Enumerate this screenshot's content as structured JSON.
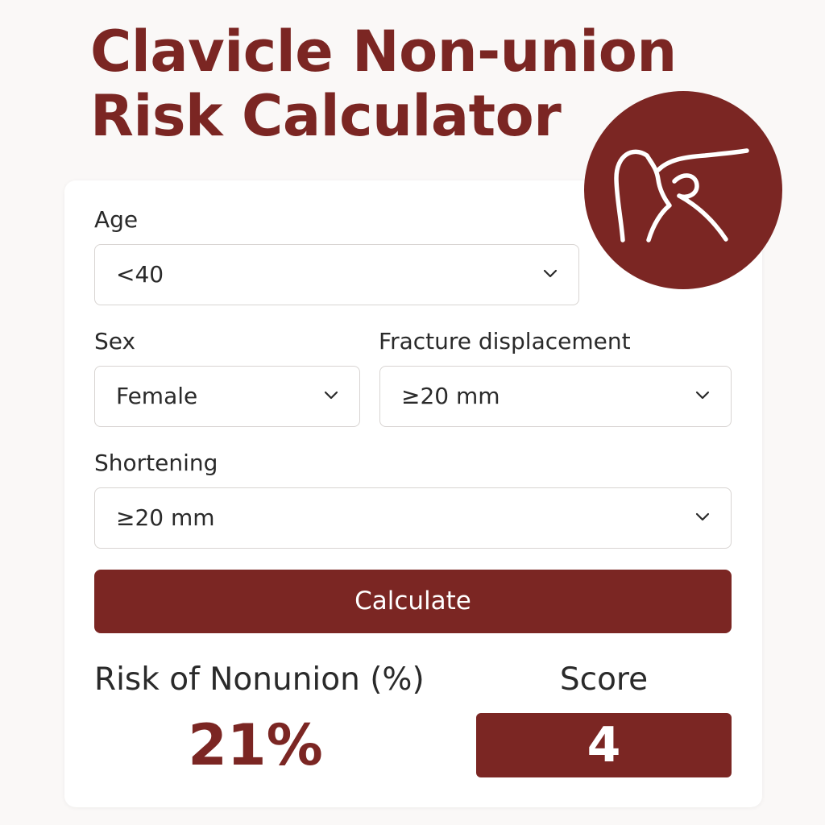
{
  "title": {
    "line1": "Clavicle Non-union",
    "line2": "Risk Calculator"
  },
  "emblem": {
    "icon": "shoulder-joint-icon"
  },
  "form": {
    "age": {
      "label": "Age",
      "value": "<40"
    },
    "sex": {
      "label": "Sex",
      "value": "Female"
    },
    "displacement": {
      "label": "Fracture displacement",
      "value": "≥20 mm"
    },
    "shortening": {
      "label": "Shortening",
      "value": "≥20 mm"
    }
  },
  "actions": {
    "calculate_label": "Calculate"
  },
  "results": {
    "risk_label": "Risk of Nonunion (%)",
    "risk_value": "21%",
    "score_label": "Score",
    "score_value": "4"
  },
  "colors": {
    "accent": "#7b2623",
    "background": "#faf8f7",
    "card": "#ffffff",
    "text": "#2a2a2a",
    "border": "#d8d4d2"
  }
}
